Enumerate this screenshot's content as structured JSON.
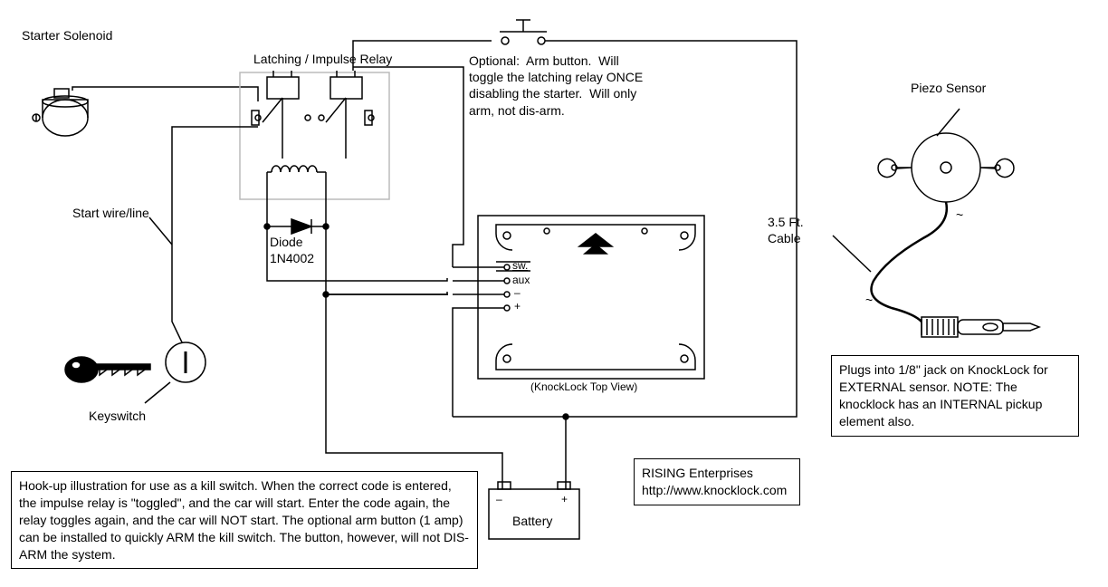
{
  "labels": {
    "starter_solenoid": "Starter Solenoid",
    "latching_relay": "Latching / Impulse Relay",
    "start_wire": "Start wire/line",
    "diode": "Diode\n1N4002",
    "keyswitch": "Keyswitch",
    "arm_button": "Optional:  Arm button.  Will\ntoggle the latching relay ONCE\ndisabling the starter.  Will only\narm, not dis-arm.",
    "knocklock_topview": "(KnockLock Top View)",
    "sw": "sw.",
    "aux": "aux",
    "minus": "–",
    "plus": "+",
    "battery": "Battery",
    "batt_minus": "–",
    "batt_plus": "+",
    "piezo": "Piezo Sensor",
    "cable": "3.5 Ft.\nCable",
    "tilde1": "~",
    "tilde2": "~"
  },
  "notes": {
    "main": "Hook-up illustration for use as a kill switch.  When the correct code is entered, the impulse relay is \"toggled\", and the car will start.  Enter the code again, the relay toggles again, and the car will NOT start.  The optional arm button (1 amp) can be installed to quickly ARM the kill switch.  The button, however, will not DIS-ARM the system.",
    "company": "RISING Enterprises\nhttp://www.knocklock.com",
    "sensor": "Plugs into 1/8\" jack on KnockLock for EXTERNAL sensor.  NOTE: The knocklock has an INTERNAL pickup element also."
  }
}
